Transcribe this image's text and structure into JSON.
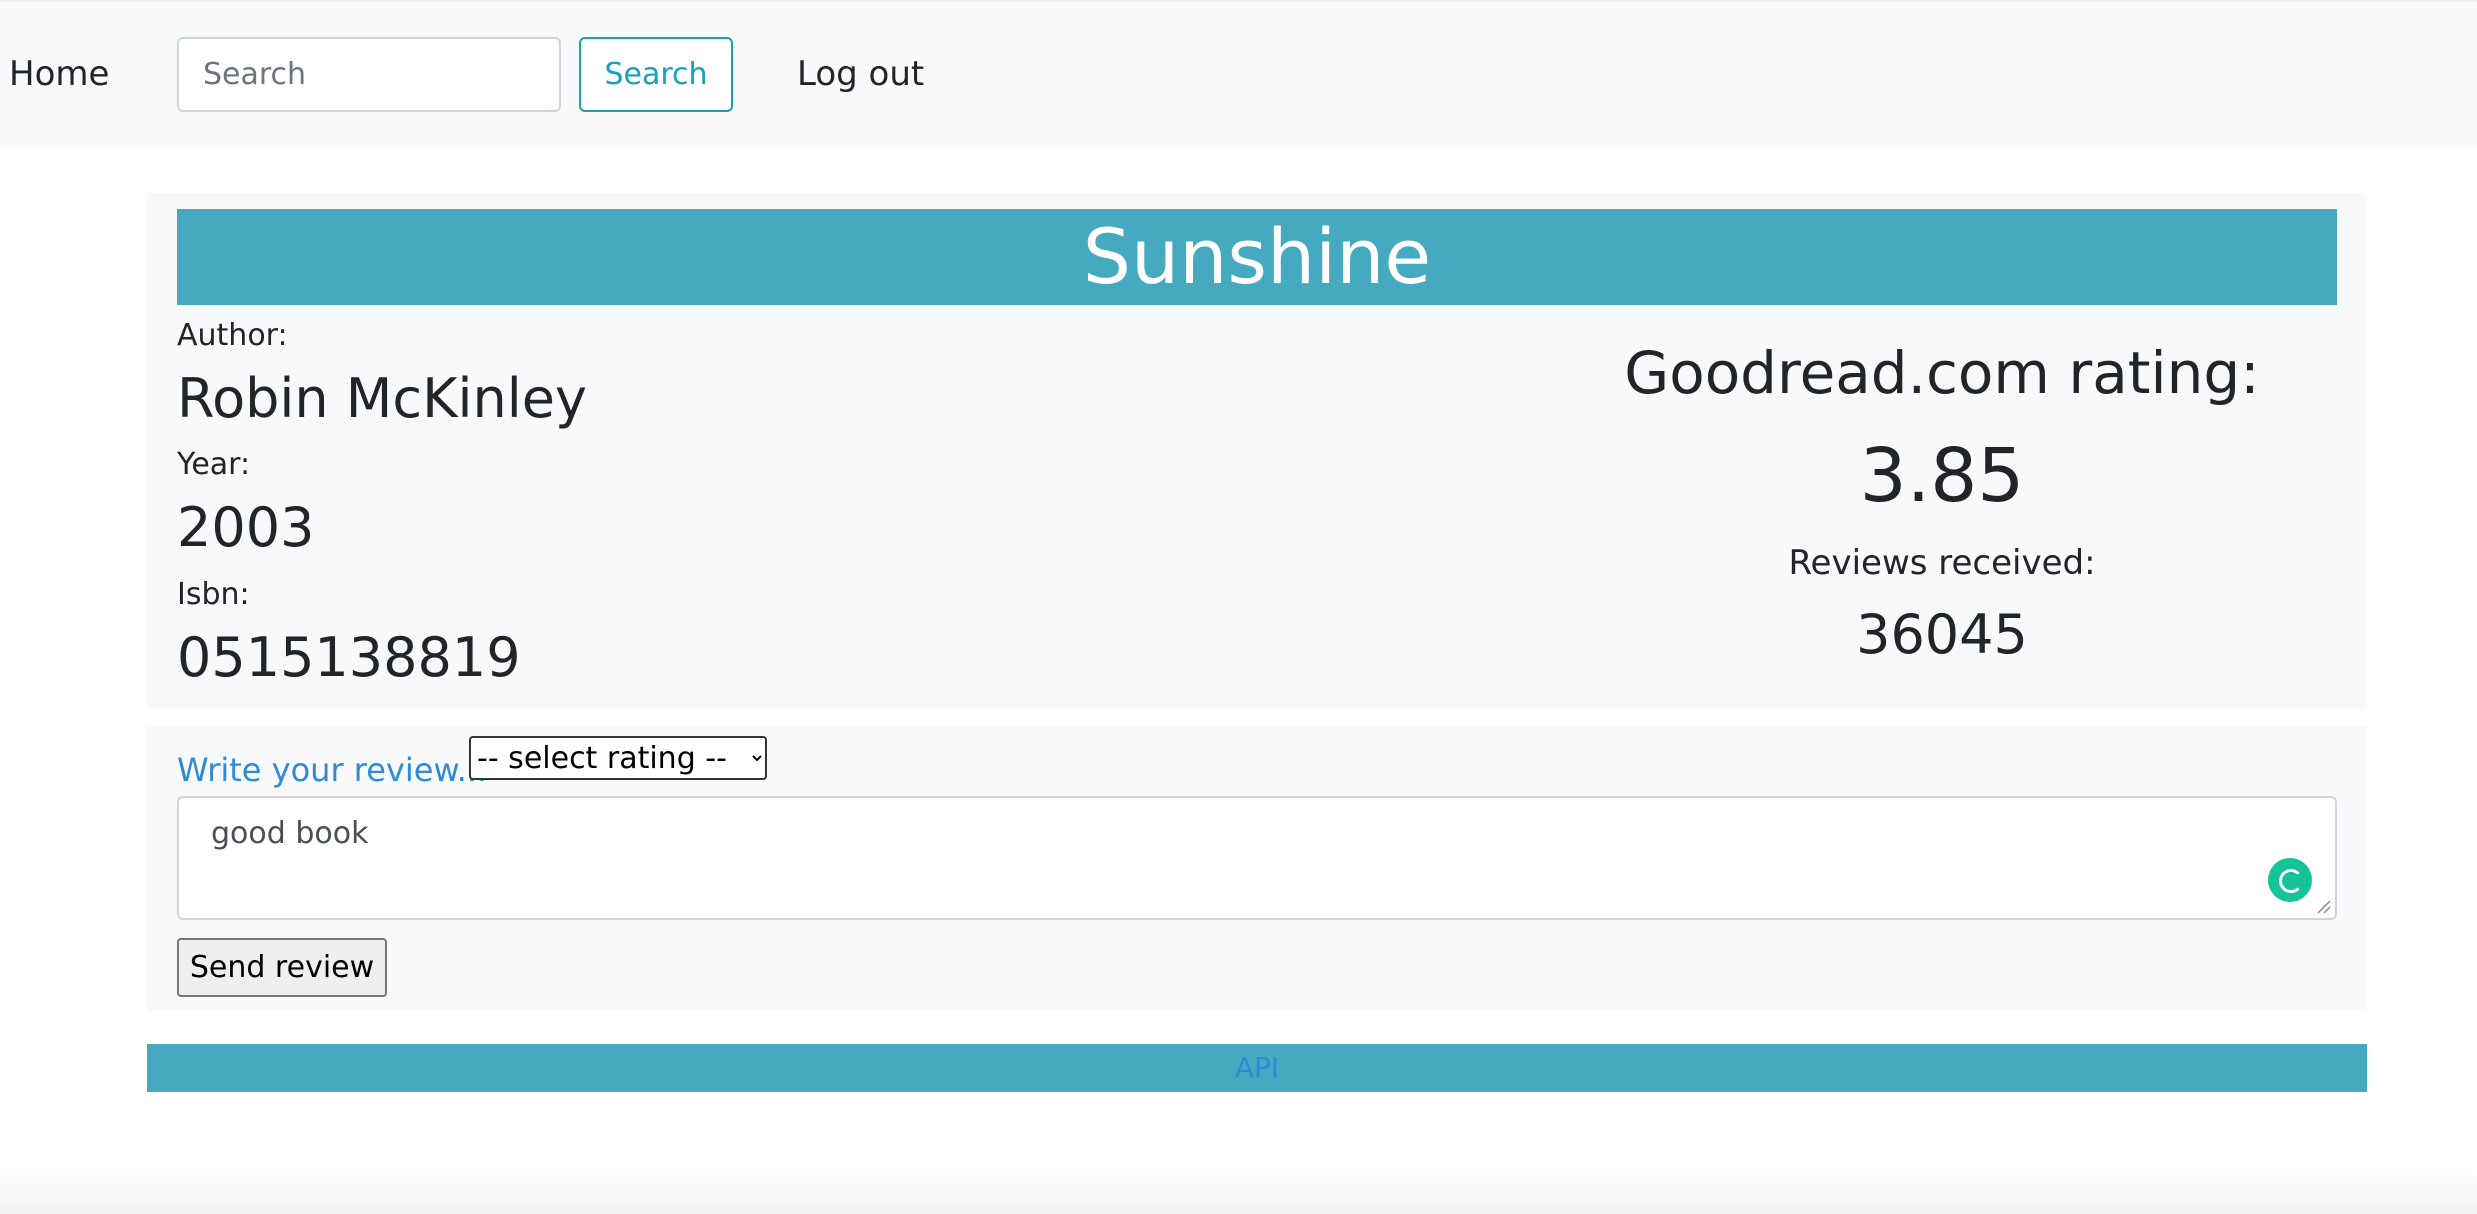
{
  "nav": {
    "home_label": "Home",
    "search_placeholder": "Search",
    "search_value": "",
    "search_button_label": "Search",
    "logout_label": "Log out"
  },
  "book": {
    "title": "Sunshine",
    "author_label": "Author:",
    "author": "Robin McKinley",
    "year_label": "Year:",
    "year": "2003",
    "isbn_label": "Isbn:",
    "isbn": "0515138819"
  },
  "rating": {
    "heading": "Goodread.com rating:",
    "value": "3.85",
    "reviews_label": "Reviews received:",
    "reviews_count": "36045"
  },
  "review_form": {
    "write_link_label": "Write your review...",
    "rating_select_selected": "-- select rating --",
    "review_text": "good book",
    "send_button_label": "Send review"
  },
  "footer": {
    "api_link_label": "API"
  },
  "colors": {
    "accent": "#45aabf",
    "link": "#2f8bd6",
    "card_bg": "#f8f9fa",
    "grammar_icon": "#15c39a"
  },
  "icons": {
    "grammar_assistant": "grammar-assistant-icon",
    "resize_grip": "resize-grip-icon"
  }
}
